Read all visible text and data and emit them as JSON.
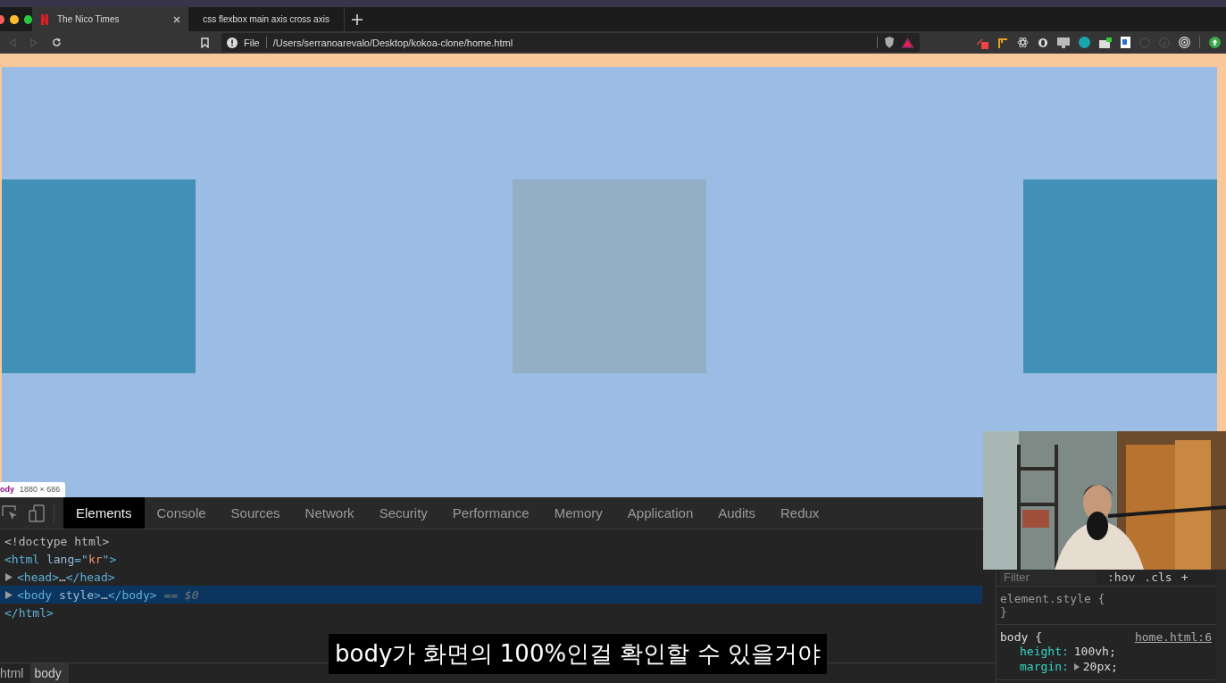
{
  "browser": {
    "tabs": [
      {
        "title": "The Nico Times",
        "selected": true,
        "kind": "n"
      },
      {
        "title": "css flexbox main axis cross axis",
        "selected": false,
        "kind": "duck"
      }
    ],
    "address": {
      "scheme": "File",
      "url": "/Users/serranoarevalo/Desktop/kokoa-clone/home.html"
    }
  },
  "page": {
    "boxes": [
      {
        "color": "#428fb8"
      },
      {
        "color": "#93afc6"
      },
      {
        "color": "#428fb8"
      }
    ],
    "element_tooltip": {
      "tag": "ody",
      "size": "1880 × 686"
    }
  },
  "devtools": {
    "tabs": [
      {
        "label": "Elements",
        "selected": true
      },
      {
        "label": "Console",
        "selected": false
      },
      {
        "label": "Sources",
        "selected": false
      },
      {
        "label": "Network",
        "selected": false
      },
      {
        "label": "Security",
        "selected": false
      },
      {
        "label": "Performance",
        "selected": false
      },
      {
        "label": "Memory",
        "selected": false
      },
      {
        "label": "Application",
        "selected": false
      },
      {
        "label": "Audits",
        "selected": false
      },
      {
        "label": "Redux",
        "selected": false
      }
    ],
    "dom_lines": [
      {
        "kind": "leaf",
        "selected": false,
        "tokens": [
          {
            "kind": "doctype",
            "text": "<!doctype html>"
          }
        ]
      },
      {
        "kind": "leaf",
        "selected": false,
        "tokens": [
          {
            "kind": "tag",
            "text": "<html "
          },
          {
            "kind": "attr",
            "text": "lang"
          },
          {
            "kind": "tag",
            "text": "=\""
          },
          {
            "kind": "value",
            "text": "kr"
          },
          {
            "kind": "tag",
            "text": "\">"
          }
        ]
      },
      {
        "kind": "node",
        "expanded": false,
        "selected": false,
        "tokens": [
          {
            "kind": "tag",
            "text": "<head>"
          },
          {
            "kind": "text",
            "text": "…"
          },
          {
            "kind": "tag",
            "text": "</head>"
          }
        ]
      },
      {
        "kind": "node",
        "expanded": false,
        "selected": true,
        "tokens": [
          {
            "kind": "tag",
            "text": "<body "
          },
          {
            "kind": "attr",
            "text": "style"
          },
          {
            "kind": "tag",
            "text": ">"
          },
          {
            "kind": "text",
            "text": "…"
          },
          {
            "kind": "tag",
            "text": "</body>"
          },
          {
            "kind": "ref",
            "text": " == $0"
          }
        ]
      },
      {
        "kind": "leaf",
        "selected": false,
        "tokens": [
          {
            "kind": "tag",
            "text": "</html>"
          }
        ]
      }
    ],
    "breadcrumbs": [
      {
        "label": "html",
        "selected": false
      },
      {
        "label": "body",
        "selected": true
      }
    ],
    "styles": {
      "filter_placeholder": "Filter",
      "buttons": [
        ":hov",
        ".cls",
        "+"
      ],
      "rules": [
        {
          "selector": "element.style {",
          "close": "}"
        },
        {
          "selector": "body {",
          "source": "home.html:6",
          "declarations": [
            {
              "property": "height:",
              "value": "100vh;",
              "expandable": false
            },
            {
              "property": "margin:",
              "value": "20px;",
              "expandable": true
            }
          ]
        }
      ]
    }
  },
  "subtitle": "body가 화면의 100%인걸 확인할 수 있을거야"
}
